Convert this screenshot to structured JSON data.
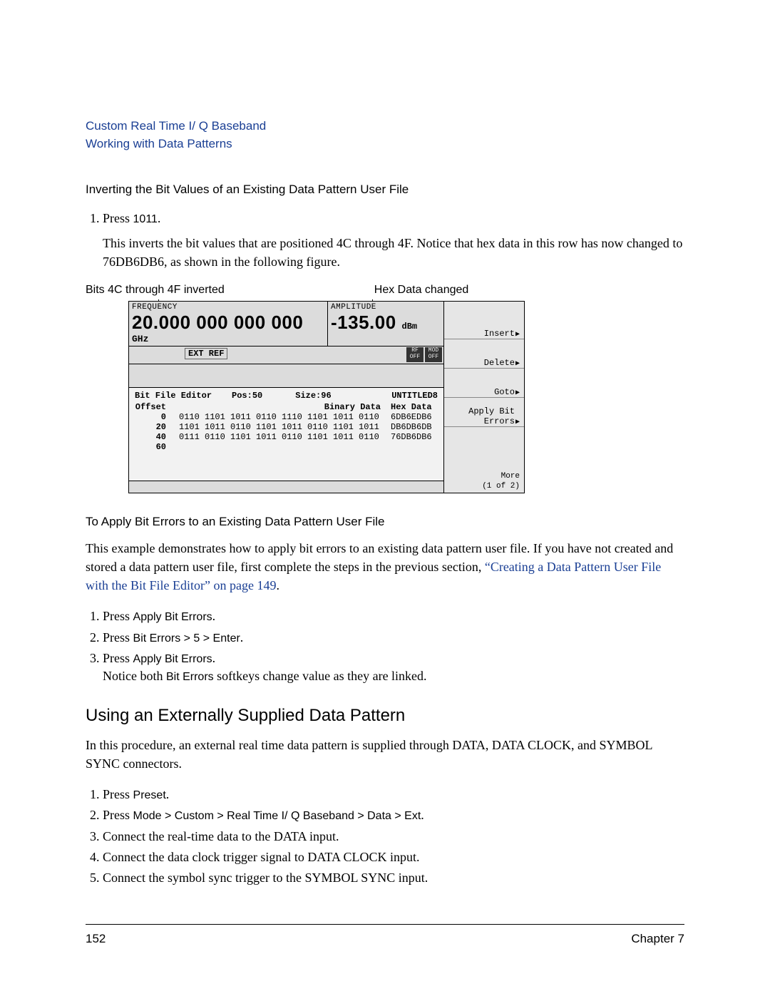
{
  "header": {
    "line1": "Custom Real Time I/ Q Baseband",
    "line2": "Working with Data Patterns"
  },
  "section1": {
    "heading": "Inverting the Bit Values of an Existing Data Pattern User File",
    "step1_prefix": "Press ",
    "step1_code": "1011",
    "step1_suffix": ".",
    "explain": "This inverts the bit values that are positioned 4C through 4F. Notice that hex data in this row has now changed to 76DB6DB6, as shown in the following figure."
  },
  "captions": {
    "left": "Bits 4C through 4F inverted",
    "right": "Hex Data changed"
  },
  "instrument": {
    "freq_label": "FREQUENCY",
    "freq_value": "20.000 000 000 000",
    "freq_unit": "GHz",
    "amp_label": "AMPLITUDE",
    "amp_value": "-135.00",
    "amp_unit": "dBm",
    "ext_ref": "EXT REF",
    "rf": "RF\nOFF",
    "mod": "MOD\nOFF",
    "editor_title": "Bit File Editor",
    "pos": "Pos:50",
    "size": "Size:96",
    "file": "UNTITLED8",
    "col_offset": "Offset",
    "col_binary": "Binary Data",
    "col_hex": "Hex Data",
    "rows": [
      {
        "offset": "0",
        "bin": "0110 1101 1011 0110 1110 1101 1011 0110",
        "hex": "6DB6EDB6"
      },
      {
        "offset": "20",
        "bin": "1101 1011 0110 1101 1011 0110 1101 1011",
        "hex": "DB6DB6DB"
      },
      {
        "offset": "40",
        "bin": "0111 0110 1101 1011 0110 1101 1011 0110",
        "hex": "76DB6DB6"
      },
      {
        "offset": "60",
        "bin": "",
        "hex": ""
      }
    ],
    "softkeys": {
      "insert": "Insert",
      "delete": "Delete",
      "goto": "Goto",
      "apply": "Apply Bit Errors",
      "more1": "More",
      "more2": "(1 of 2)"
    }
  },
  "section2": {
    "heading": "To Apply Bit Errors to an Existing Data Pattern User File",
    "para_a": "This example demonstrates how to apply bit errors to an existing data pattern user file. If you have not created and stored a data pattern user file, first complete the steps in the previous section, ",
    "link": "“Creating a Data Pattern User File with the Bit File Editor” on page 149",
    "para_b": ".",
    "s1_prefix": "Press ",
    "s1_code": "Apply Bit Errors",
    "s1_suffix": ".",
    "s2_prefix": "Press ",
    "s2_code": "Bit Errors > 5 > Enter",
    "s2_suffix": ".",
    "s3_prefix": "Press ",
    "s3_code": "Apply Bit Errors",
    "s3_suffix": ".",
    "s3_note_a": "Notice both ",
    "s3_note_code": "Bit Errors",
    "s3_note_b": " softkeys change value as they are linked."
  },
  "section3": {
    "heading": "Using an Externally Supplied Data Pattern",
    "para": "In this procedure, an external real time data pattern is supplied through DATA, DATA CLOCK, and SYMBOL SYNC connectors.",
    "s1_prefix": "Press ",
    "s1_code": "Preset",
    "s1_suffix": ".",
    "s2_prefix": "Press ",
    "s2_code": "Mode > Custom > Real Time I/ Q Baseband > Data > Ext",
    "s2_suffix": ".",
    "s3": "Connect the real-time data to the DATA input.",
    "s4": "Connect the data clock trigger signal to DATA CLOCK input.",
    "s5": "Connect the symbol sync trigger to the SYMBOL SYNC input."
  },
  "footer": {
    "page": "152",
    "chapter": "Chapter 7"
  }
}
